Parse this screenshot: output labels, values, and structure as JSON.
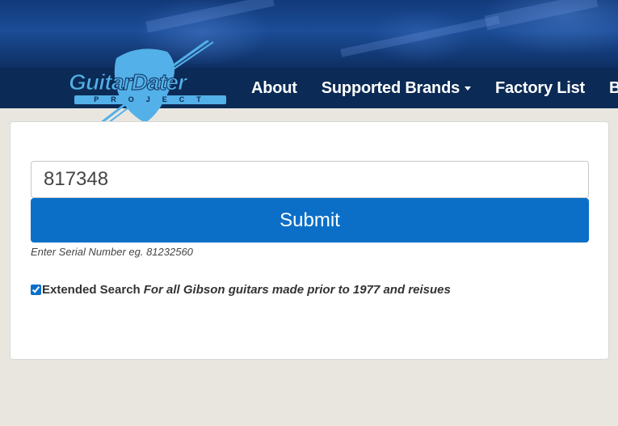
{
  "header": {
    "logo": {
      "word": "GuitarDater",
      "sub": "PROJECT"
    },
    "nav": [
      {
        "label": "About"
      },
      {
        "label": "Supported Brands",
        "has_dropdown": true
      },
      {
        "label": "Factory List"
      },
      {
        "label": "Blo"
      }
    ]
  },
  "form": {
    "serial_value": "817348",
    "submit_label": "Submit",
    "help_text": "Enter Serial Number eg. 81232560",
    "extended_search": {
      "checked": true,
      "label": "Extended Search",
      "note": "For all Gibson guitars made prior to 1977 and reisues"
    }
  },
  "colors": {
    "nav_bg": "#0b2a55",
    "accent": "#0b6fc8",
    "logo_blue": "#53b0e8",
    "page_bg": "#e9e6e0"
  }
}
